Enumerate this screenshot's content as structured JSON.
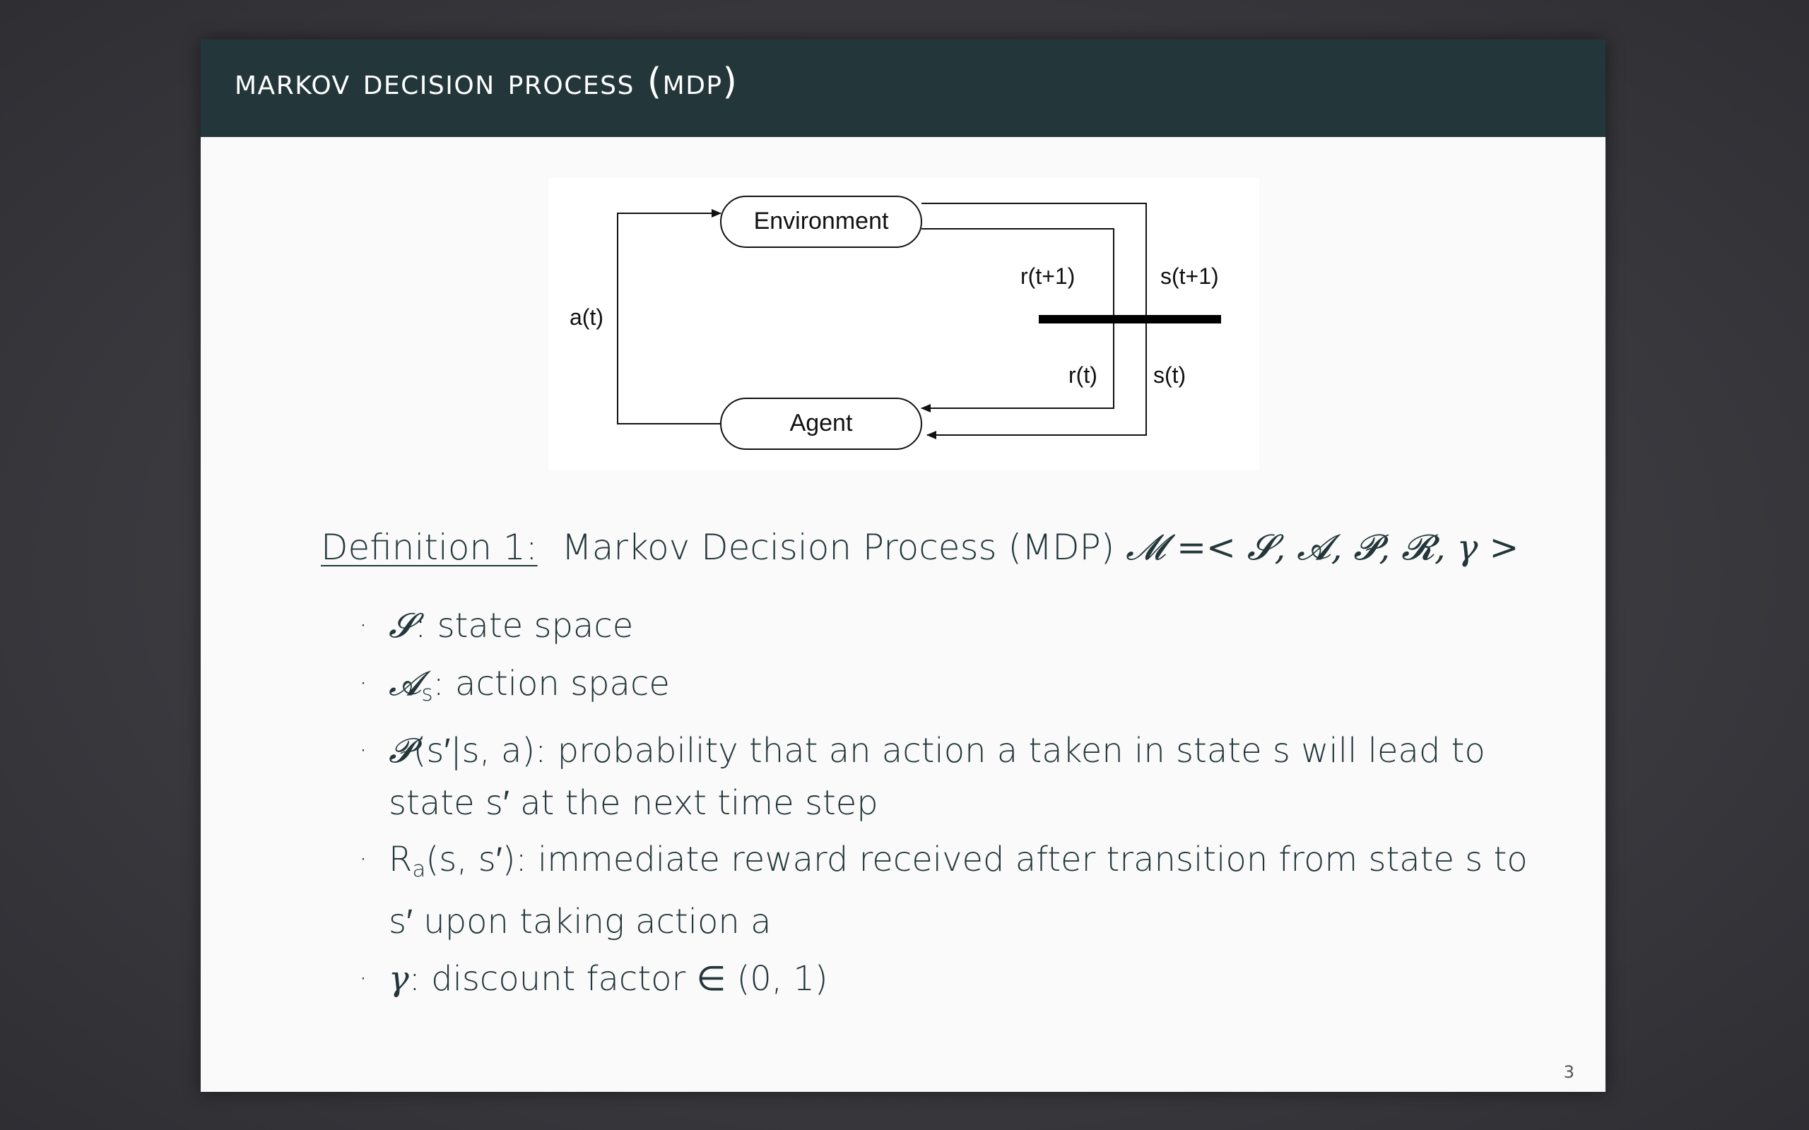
{
  "frame": {
    "title": "Markov Decision Process (MDP)",
    "page_number": "3"
  },
  "diagram": {
    "environment_label": "Environment",
    "agent_label": "Agent",
    "action_label": "a(t)",
    "reward_next_label": "r(t+1)",
    "state_next_label": "s(t+1)",
    "reward_label": "r(t)",
    "state_label": "s(t)"
  },
  "definition": {
    "label": "Definition 1:",
    "text": "Markov Decision Process (MDP)",
    "formula": "𝓜 =< 𝓢, 𝓐, 𝓟, 𝓡, γ >"
  },
  "bullets": [
    {
      "symbol": "𝓢",
      "text": ": state space"
    },
    {
      "symbol": "𝓐",
      "sub": "s",
      "text": ": action space"
    },
    {
      "symbol": "𝓟",
      "text": "(s′|s, a): probability that an action a taken in state s will lead to state s′ at the next time step"
    },
    {
      "symbol": "R",
      "sub": "a",
      "text": "(s, s′): immediate reward received after transition from state s to s′ upon taking action a"
    },
    {
      "symbol": "γ",
      "text": ": discount factor ∈ (0, 1)"
    }
  ],
  "bullet_glyph": "·",
  "colors": {
    "title_bar": "#23373b",
    "slide_bg": "#fafafa",
    "text": "#23373b"
  }
}
